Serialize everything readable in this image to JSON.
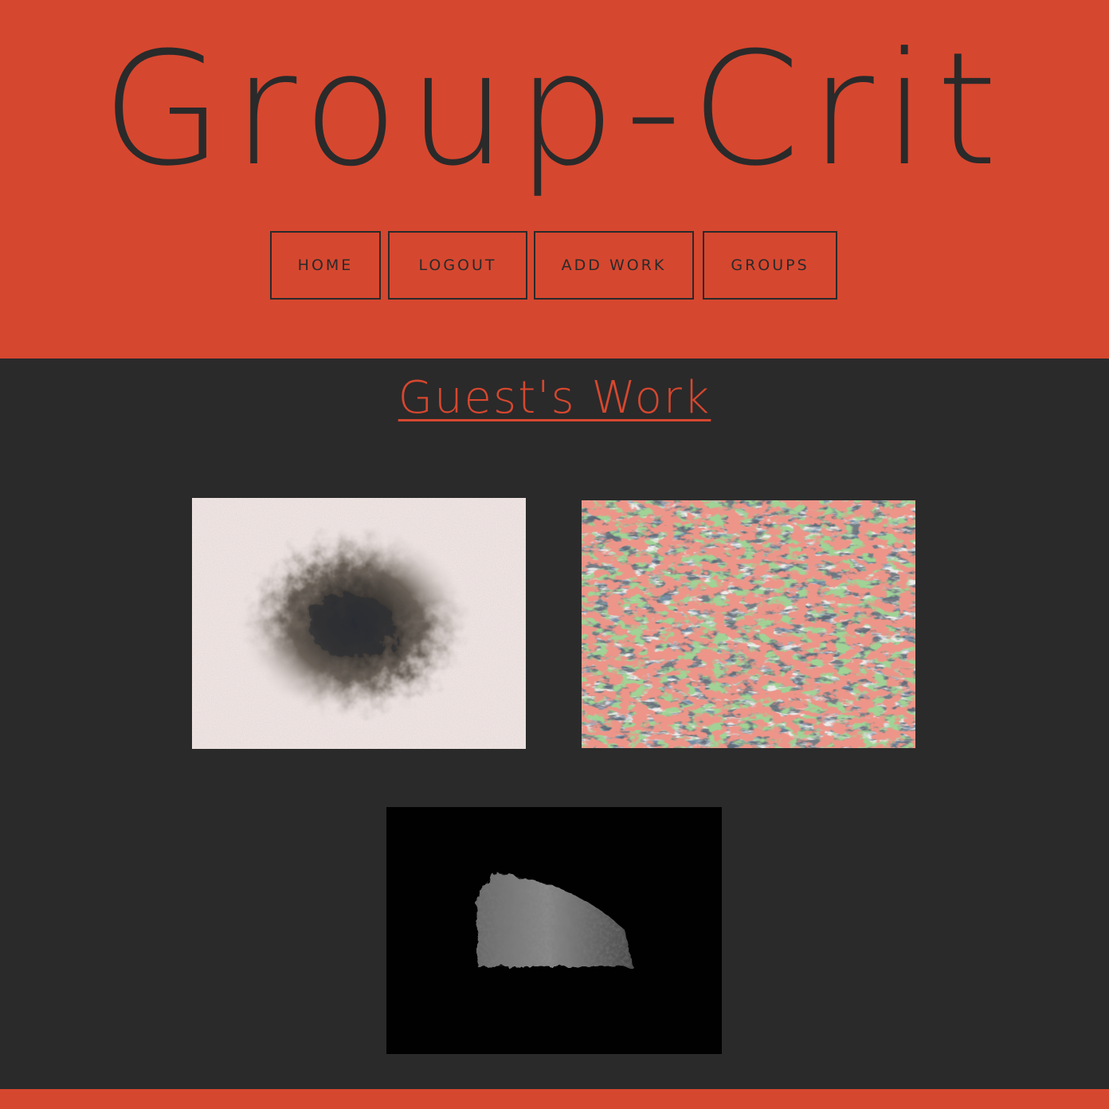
{
  "site": {
    "title": "Group-Crit",
    "brand_color": "#d6472f",
    "background_color": "#2a2a2a",
    "text_color": "#2a2a2a"
  },
  "nav": {
    "items": [
      {
        "label": "HOME"
      },
      {
        "label": "LOGOUT"
      },
      {
        "label": "ADD WORK"
      },
      {
        "label": "GROUPS"
      }
    ]
  },
  "main": {
    "heading": "Guest's Work",
    "artworks": [
      {
        "style": "dark radial burst on pale background"
      },
      {
        "style": "multicolor abstract scribble"
      },
      {
        "style": "grey textured fragment on black"
      }
    ]
  }
}
